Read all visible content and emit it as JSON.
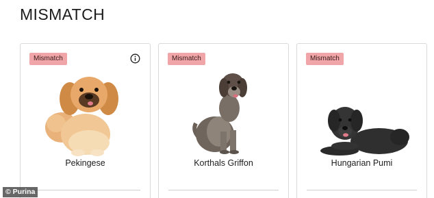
{
  "page": {
    "title": "MISMATCH"
  },
  "cards": [
    {
      "badge": "Mismatch",
      "name": "Pekingese",
      "info_icon": "info-circle-icon"
    },
    {
      "badge": "Mismatch",
      "name": "Korthals Griffon"
    },
    {
      "badge": "Mismatch",
      "name": "Hungarian Pumi"
    }
  ],
  "credit": "© Purina",
  "colors": {
    "badge_bg": "#f0a6a8",
    "border": "#d9d9d9"
  }
}
